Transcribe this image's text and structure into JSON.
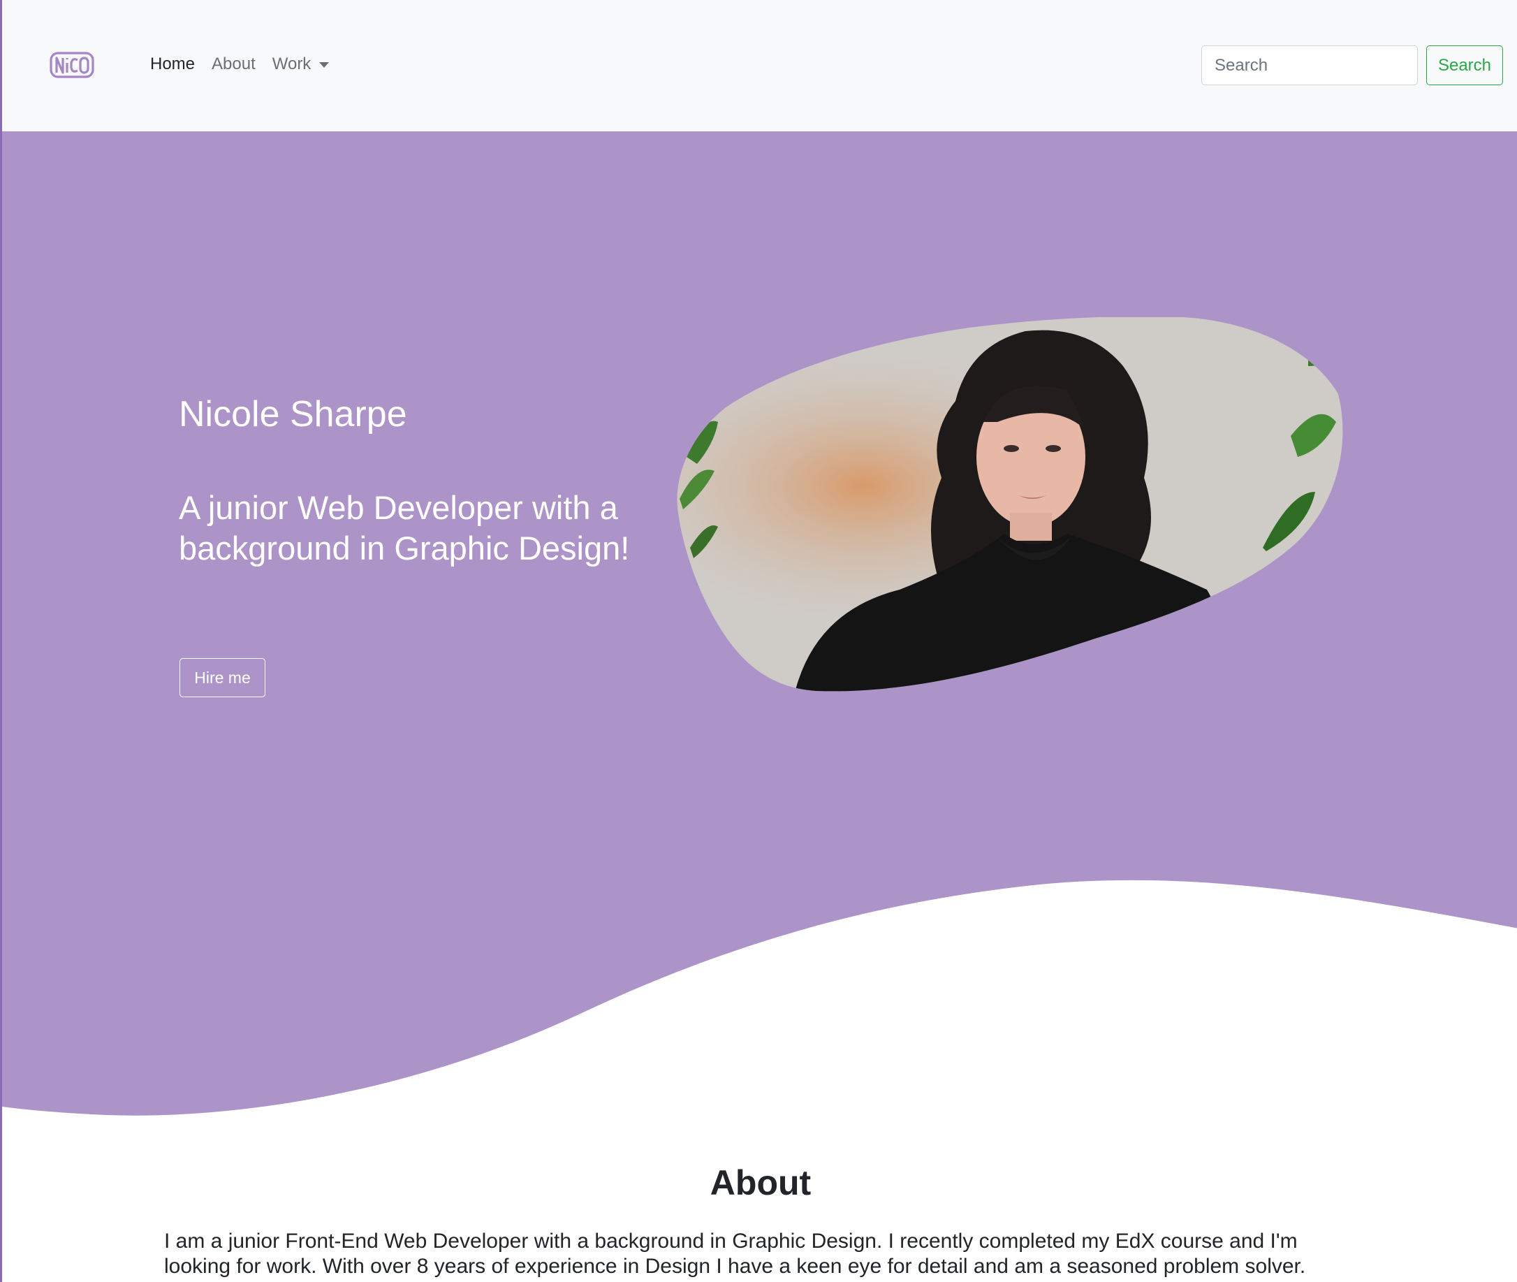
{
  "navbar": {
    "logo_text": "NiCO",
    "links": [
      {
        "label": "Home",
        "active": true
      },
      {
        "label": "About",
        "active": false
      },
      {
        "label": "Work",
        "active": false
      }
    ],
    "search": {
      "placeholder": "Search",
      "button_label": "Search"
    }
  },
  "hero": {
    "name": "Nicole Sharpe",
    "tagline": "A junior Web Developer with a background in Graphic Design!",
    "cta_label": "Hire me",
    "portrait_icon": "portrait-photo"
  },
  "about": {
    "heading": "About",
    "text": "I am a junior Front-End Web Developer with a background in Graphic Design. I recently completed my EdX course and I'm looking for work. With over 8 years of experience in Design I have a keen eye for detail and am a seasoned problem solver."
  },
  "colors": {
    "hero_bg": "#ad94c8",
    "logo": "#a585c5",
    "navbar_bg": "#f8f9fa",
    "search_button": "#28a745"
  }
}
